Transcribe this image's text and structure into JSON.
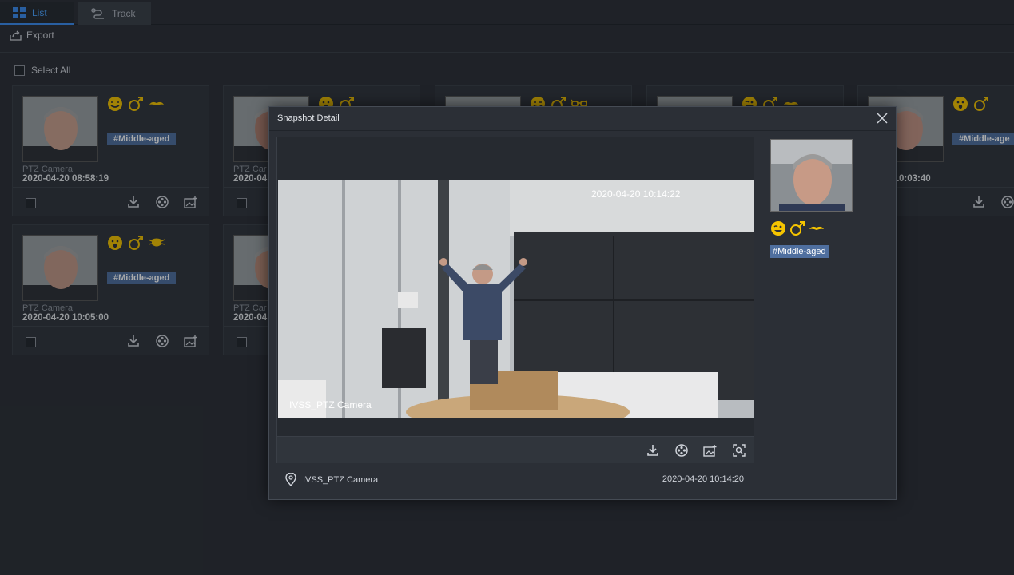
{
  "tabs": [
    {
      "label": "List",
      "icon": "grid-icon"
    },
    {
      "label": "Track",
      "icon": "track-icon"
    }
  ],
  "toolbar": {
    "export_label": "Export"
  },
  "select_all_label": "Select All",
  "colors": {
    "accent": "#3b8df0",
    "attr_icon": "#f5c400",
    "tag_bg": "#4f6f9f"
  },
  "cards": [
    {
      "camera": "PTZ Camera",
      "time": "2020-04-20 08:58:19",
      "tag": "#Middle-aged",
      "attrs": [
        "smile-icon",
        "male-icon",
        "mustache-icon"
      ]
    },
    {
      "camera": "PTZ Car",
      "time": "2020-04",
      "tag": "",
      "attrs": [
        "surprised-icon",
        "male-icon"
      ]
    },
    {
      "camera": "",
      "time": "",
      "tag": "",
      "attrs": [
        "smile-icon",
        "male-icon",
        "glasses-icon"
      ]
    },
    {
      "camera": "",
      "time": "",
      "tag": "",
      "attrs": [
        "wink-icon",
        "male-icon",
        "mustache-icon"
      ]
    },
    {
      "camera": "amera",
      "time": "04-20 10:03:40",
      "tag": "#Middle-age",
      "attrs": [
        "surprised-icon",
        "male-icon"
      ]
    },
    {
      "camera": "PTZ Camera",
      "time": "2020-04-20 10:05:00",
      "tag": "#Middle-aged",
      "attrs": [
        "surprised-icon",
        "male-icon",
        "mask-icon"
      ]
    },
    {
      "camera": "PTZ Car",
      "time": "2020-04",
      "tag": "",
      "attrs": []
    }
  ],
  "modal": {
    "title": "Snapshot Detail",
    "video_timestamp": "2020-04-20 10:14:22",
    "video_channel": "IVSS_PTZ Camera",
    "location": "IVSS_PTZ Camera",
    "time": "2020-04-20 10:14:20",
    "tag": "#Middle-aged",
    "attrs": [
      "wink-icon",
      "male-icon",
      "mustache-icon"
    ]
  }
}
